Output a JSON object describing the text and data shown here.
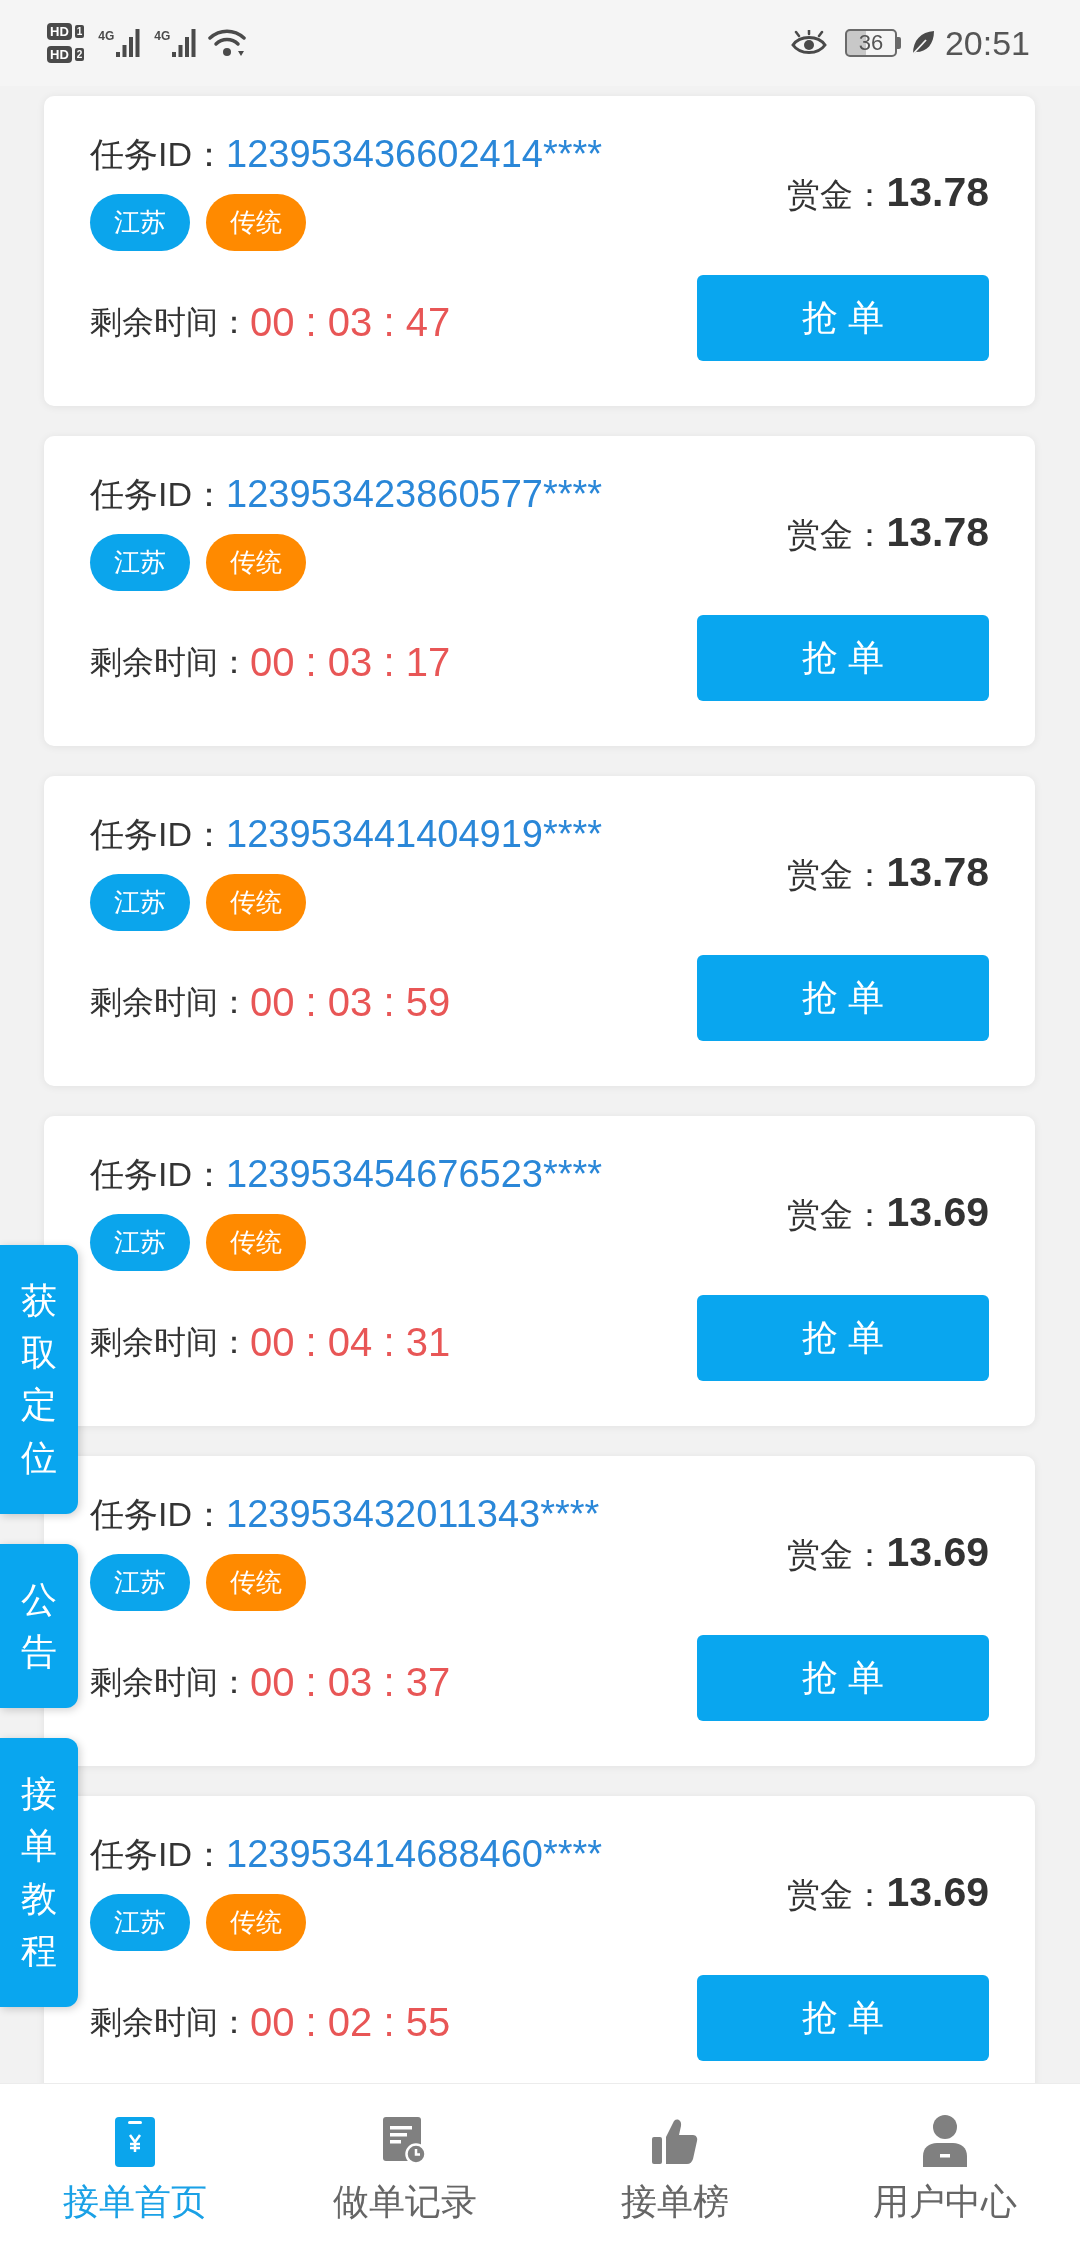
{
  "status_bar": {
    "sims": [
      {
        "badge": "HD",
        "slot": "1",
        "network": "4G"
      },
      {
        "badge": "HD",
        "slot": "2",
        "network": "4G"
      }
    ],
    "battery": "36",
    "time": "20:51"
  },
  "orders": [
    {
      "id_label": "任务ID：",
      "id": "123953436602414****",
      "tags": [
        {
          "text": "江苏",
          "color": "#0ba5ec"
        },
        {
          "text": "传统",
          "color": "#ff8a00"
        }
      ],
      "reward_label": "赏金：",
      "reward": "13.78",
      "time_label": "剩余时间：",
      "time": "00 : 03 : 47",
      "button": "抢 单"
    },
    {
      "id_label": "任务ID：",
      "id": "123953423860577****",
      "tags": [
        {
          "text": "江苏",
          "color": "#0ba5ec"
        },
        {
          "text": "传统",
          "color": "#ff8a00"
        }
      ],
      "reward_label": "赏金：",
      "reward": "13.78",
      "time_label": "剩余时间：",
      "time": "00 : 03 : 17",
      "button": "抢 单"
    },
    {
      "id_label": "任务ID：",
      "id": "123953441404919****",
      "tags": [
        {
          "text": "江苏",
          "color": "#0ba5ec"
        },
        {
          "text": "传统",
          "color": "#ff8a00"
        }
      ],
      "reward_label": "赏金：",
      "reward": "13.78",
      "time_label": "剩余时间：",
      "time": "00 : 03 : 59",
      "button": "抢 单"
    },
    {
      "id_label": "任务ID：",
      "id": "123953454676523****",
      "tags": [
        {
          "text": "江苏",
          "color": "#0ba5ec"
        },
        {
          "text": "传统",
          "color": "#ff8a00"
        }
      ],
      "reward_label": "赏金：",
      "reward": "13.69",
      "time_label": "剩余时间：",
      "time": "00 : 04 : 31",
      "button": "抢 单"
    },
    {
      "id_label": "任务ID：",
      "id": "123953432011343****",
      "tags": [
        {
          "text": "江苏",
          "color": "#0ba5ec"
        },
        {
          "text": "传统",
          "color": "#ff8a00"
        }
      ],
      "reward_label": "赏金：",
      "reward": "13.69",
      "time_label": "剩余时间：",
      "time": "00 : 03 : 37",
      "button": "抢 单"
    },
    {
      "id_label": "任务ID：",
      "id": "123953414688460****",
      "tags": [
        {
          "text": "江苏",
          "color": "#0ba5ec"
        },
        {
          "text": "传统",
          "color": "#ff8a00"
        }
      ],
      "reward_label": "赏金：",
      "reward": "13.69",
      "time_label": "剩余时间：",
      "time": "00 : 02 : 55",
      "button": "抢 单"
    }
  ],
  "side_buttons": [
    {
      "label": "获取定位"
    },
    {
      "label": "公告"
    },
    {
      "label": "接单教程"
    }
  ],
  "bottom_nav": [
    {
      "kind": "home",
      "label": "接单首页",
      "selected": true
    },
    {
      "kind": "records",
      "label": "做单记录",
      "selected": false
    },
    {
      "kind": "ranking",
      "label": "接单榜",
      "selected": false
    },
    {
      "kind": "user",
      "label": "用户中心",
      "selected": false
    }
  ]
}
